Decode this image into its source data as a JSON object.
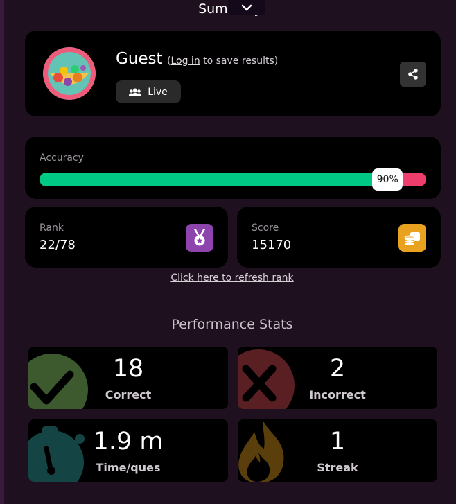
{
  "header": {
    "title": "Summary"
  },
  "profile": {
    "name": "Guest",
    "note_open": "(",
    "login_label": "Log in",
    "note_rest": " to save results)",
    "mode_label": "Live"
  },
  "accuracy": {
    "label": "Accuracy",
    "value_text": "90%",
    "value": 0.9
  },
  "rank": {
    "label": "Rank",
    "value": "22/78"
  },
  "score": {
    "label": "Score",
    "value": "15170"
  },
  "refresh_label": "Click here to refresh rank",
  "performance": {
    "title": "Performance Stats",
    "correct": {
      "value": "18",
      "label": "Correct"
    },
    "incorrect": {
      "value": "2",
      "label": "Incorrect"
    },
    "time": {
      "value": "1.9 m",
      "label": "Time/ques"
    },
    "streak": {
      "value": "1",
      "label": "Streak"
    }
  },
  "colors": {
    "accuracy_fill": "#00c985",
    "accuracy_track": "#ef3e6b",
    "rank_icon_bg": "#8e44ad",
    "score_icon_bg": "#e8a21f"
  },
  "icons": {
    "collapse": "chevron-down-icon",
    "share": "share-icon",
    "live": "users-icon",
    "rank": "medal-icon",
    "score": "coins-icon",
    "correct": "check-icon",
    "incorrect": "cross-icon",
    "time": "stopwatch-icon",
    "streak": "flame-icon"
  }
}
